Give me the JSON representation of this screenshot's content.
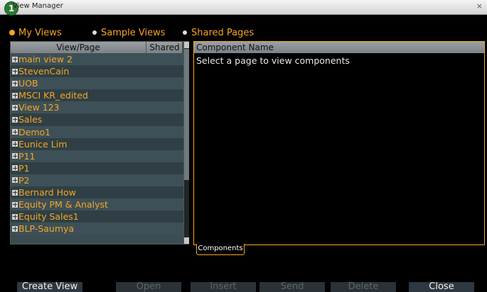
{
  "window": {
    "title": "View Manager",
    "close_glyph": "×",
    "step_badge": "1"
  },
  "scope": {
    "options": [
      "My Views",
      "Sample Views",
      "Shared Pages"
    ],
    "selected": "My Views"
  },
  "views_table": {
    "columns": [
      "View/Page",
      "Shared"
    ],
    "rows": [
      "main view 2",
      "StevenCain",
      "UOB",
      "MSCI KR_edited",
      "View 123",
      "Sales",
      "Demo1",
      "Eunice Lim",
      "P11",
      "P1",
      "P2",
      "Bernard How",
      "Equity PM & Analyst",
      "Equity Sales1",
      "BLP-Saumya"
    ]
  },
  "components": {
    "header": "Component Name",
    "message": "Select a page to view components",
    "tab_label": "Components"
  },
  "buttons": {
    "create_view": "Create View",
    "open": "Open",
    "insert": "Insert",
    "send": "Send",
    "delete": "Delete",
    "close": "Close"
  },
  "colors": {
    "accent": "#f5a623",
    "row_bg": "#3e5057",
    "header_bg": "#8a9094"
  },
  "icons": {
    "expand": "plus-box-icon",
    "radio": "radio-dot-icon"
  }
}
